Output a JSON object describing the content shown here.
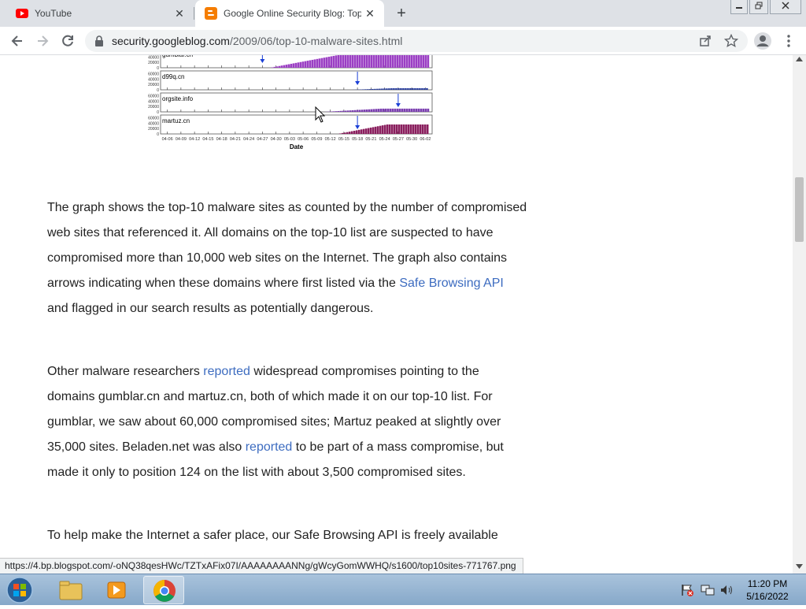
{
  "browser": {
    "tabs": [
      {
        "title": "YouTube",
        "icon": "youtube-icon"
      },
      {
        "title": "Google Online Security Blog: Top",
        "icon": "blogger-icon"
      }
    ],
    "close_glyph": "✕",
    "new_tab_glyph": "+",
    "url_host": "security.googleblog.com",
    "url_path": "/2009/06/top-10-malware-sites.html"
  },
  "chart_data": {
    "type": "bar",
    "xlabel": "Date",
    "x_ticks": [
      "04-06",
      "04-09",
      "04-12",
      "04-15",
      "04-18",
      "04-21",
      "04-24",
      "04-27",
      "04-30",
      "05-03",
      "05-06",
      "05-09",
      "05-12",
      "05-15",
      "05-18",
      "05-21",
      "05-24",
      "05-27",
      "05-30",
      "06-02"
    ],
    "y_ticks": [
      "60000",
      "40000",
      "20000",
      "0"
    ],
    "series": [
      {
        "name": "gumblar.cn",
        "color": "#9b3fc4",
        "arrow_at": "04-27",
        "start": "04-30",
        "peak": 60000
      },
      {
        "name": "d99q.cn",
        "color": "#2a3f9e",
        "arrow_at": "05-18",
        "start": "05-18",
        "peak": 6000
      },
      {
        "name": "orgsite.info",
        "color": "#7b3fb0",
        "arrow_at": "05-27",
        "start": "05-12",
        "peak": 12000
      },
      {
        "name": "martuz.cn",
        "color": "#8a1f5e",
        "arrow_at": "05-18",
        "start": "05-15",
        "peak": 35000
      }
    ]
  },
  "article": {
    "p1_a": "The graph shows the top-10 malware sites as counted by the number of compromised web sites that referenced it. All domains on the top-10 list are suspected to have compromised more than 10,000 web sites on the Internet. The graph also contains arrows indicating when these domains where first listed via the ",
    "p1_link": "Safe Browsing API",
    "p1_b": " and flagged in our search results as potentially dangerous.",
    "p2_a": "Other malware researchers ",
    "p2_link1": "reported",
    "p2_b": " widespread compromises pointing to the domains gumblar.cn and martuz.cn, both of which made it on our top-10 list. For gumblar, we saw about 60,000 compromised sites; Martuz peaked at slightly over 35,000 sites. Beladen.net was also ",
    "p2_link2": "reported",
    "p2_c": " to be part of a mass compromise, but made it only to position 124 on the list with about 3,500 compromised sites.",
    "p3": "To help make the Internet a safer place, our Safe Browsing API is freely available"
  },
  "status_url": "https://4.bp.blogspot.com/-oNQ38qesHWc/TZTxAFix07I/AAAAAAAANNg/gWcyGomWWHQ/s1600/top10sites-771767.png",
  "taskbar": {
    "time": "11:20 PM",
    "date": "5/16/2022"
  },
  "colors": {
    "link": "#3d6cc0",
    "tabstrip": "#dee1e6"
  }
}
